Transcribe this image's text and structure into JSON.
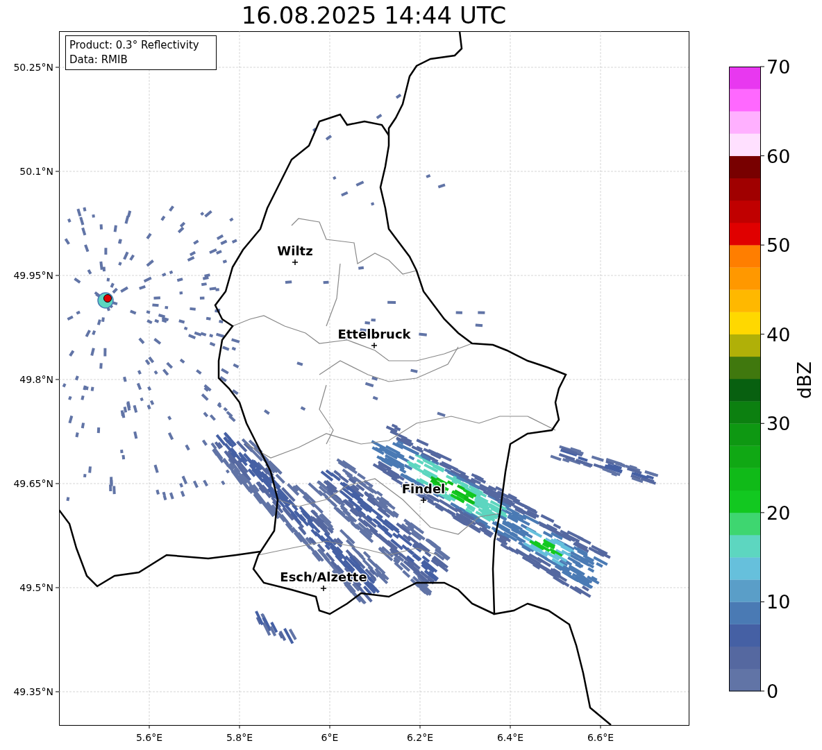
{
  "title": "16.08.2025 14:44 UTC",
  "info_box": {
    "lines": [
      "Product: 0.3° Reflectivity",
      "Data: RMIB"
    ]
  },
  "map": {
    "y_ticks": [
      "50.25°N",
      "50.1°N",
      "49.95°N",
      "49.8°N",
      "49.65°N",
      "49.5°N",
      "49.35°N"
    ],
    "x_ticks": [
      "5.6°E",
      "5.8°E",
      "6°E",
      "6.2°E",
      "6.4°E",
      "6.6°E"
    ],
    "cities": [
      {
        "name": "Wiltz"
      },
      {
        "name": "Ettelbruck"
      },
      {
        "name": "Findel"
      },
      {
        "name": "Esch/Alzette"
      }
    ]
  },
  "colorbar": {
    "label": "dBZ",
    "ticks": [
      "70",
      "60",
      "50",
      "40",
      "30",
      "20",
      "10",
      "0"
    ],
    "bands": [
      {
        "color": "#6174a6"
      },
      {
        "color": "#5568a0"
      },
      {
        "color": "#4560a4"
      },
      {
        "color": "#4a7ab4"
      },
      {
        "color": "#5a9ec8"
      },
      {
        "color": "#66c0dc"
      },
      {
        "color": "#5dd6c0"
      },
      {
        "color": "#3ed670"
      },
      {
        "color": "#12c820"
      },
      {
        "color": "#10ba18"
      },
      {
        "color": "#10a814"
      },
      {
        "color": "#0e9812"
      },
      {
        "color": "#0c8010"
      },
      {
        "color": "#086010"
      },
      {
        "color": "#40780e"
      },
      {
        "color": "#b0b008"
      },
      {
        "color": "#ffd800"
      },
      {
        "color": "#ffb800"
      },
      {
        "color": "#ff9800"
      },
      {
        "color": "#ff7e00"
      },
      {
        "color": "#e00000"
      },
      {
        "color": "#c00000"
      },
      {
        "color": "#a00000"
      },
      {
        "color": "#780000"
      },
      {
        "color": "#ffe0ff"
      },
      {
        "color": "#ffb0ff"
      },
      {
        "color": "#ff68ff"
      },
      {
        "color": "#e838f0"
      }
    ]
  }
}
